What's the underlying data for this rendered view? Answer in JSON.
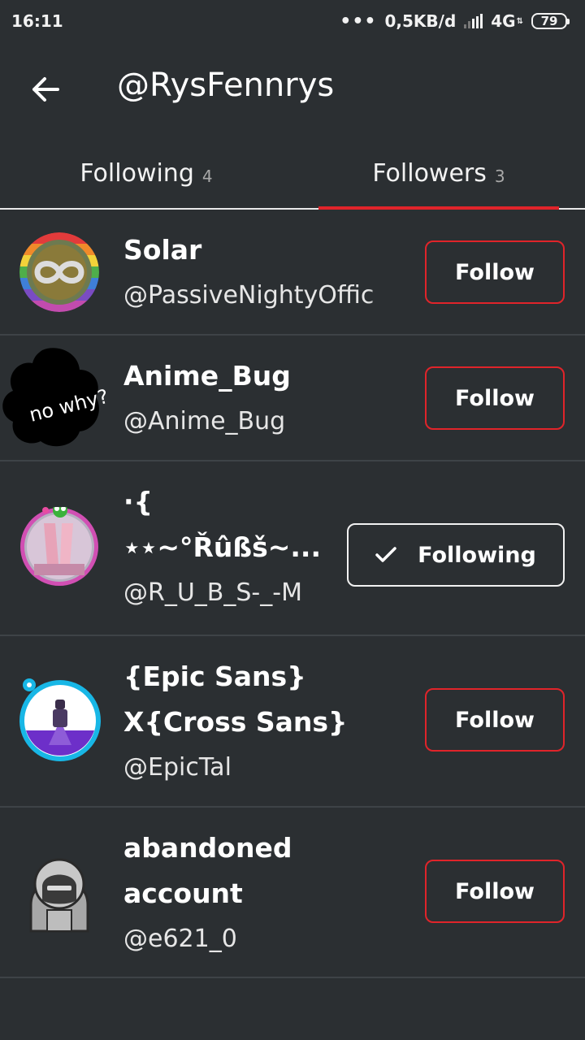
{
  "status_bar": {
    "time": "16:11",
    "dots": "•••",
    "data_speed": "0,5KB/d",
    "network": "4G",
    "battery": "79"
  },
  "header": {
    "back_icon": "arrow-left-icon",
    "title": "@RysFennrys"
  },
  "tabs": [
    {
      "label": "Following",
      "count": "4",
      "active": false
    },
    {
      "label": "Followers",
      "count": "3",
      "active": true
    }
  ],
  "colors": {
    "background": "#2b2f32",
    "accent": "#e0242a",
    "divider": "#3e4347"
  },
  "followers": [
    {
      "name_lines": [
        "Solar"
      ],
      "handle": "@PassiveNightyOffic",
      "button": "Follow",
      "avatar_text": ""
    },
    {
      "name_lines": [
        "Anime_Bug"
      ],
      "handle": "@Anime_Bug",
      "button": "Follow",
      "avatar_text": "no why?"
    },
    {
      "name_lines": [
        "·{",
        "⋆⋆~°Řûßš~..."
      ],
      "handle": "@R_U_B_S-_-M",
      "button": "Following",
      "avatar_text": ""
    },
    {
      "name_lines": [
        "{Epic Sans}",
        "X{Cross Sans}"
      ],
      "handle": "@EpicTal",
      "button": "Follow",
      "avatar_text": ""
    },
    {
      "name_lines": [
        "abandoned",
        "account"
      ],
      "handle": "@e621_0",
      "button": "Follow",
      "avatar_text": ""
    }
  ]
}
